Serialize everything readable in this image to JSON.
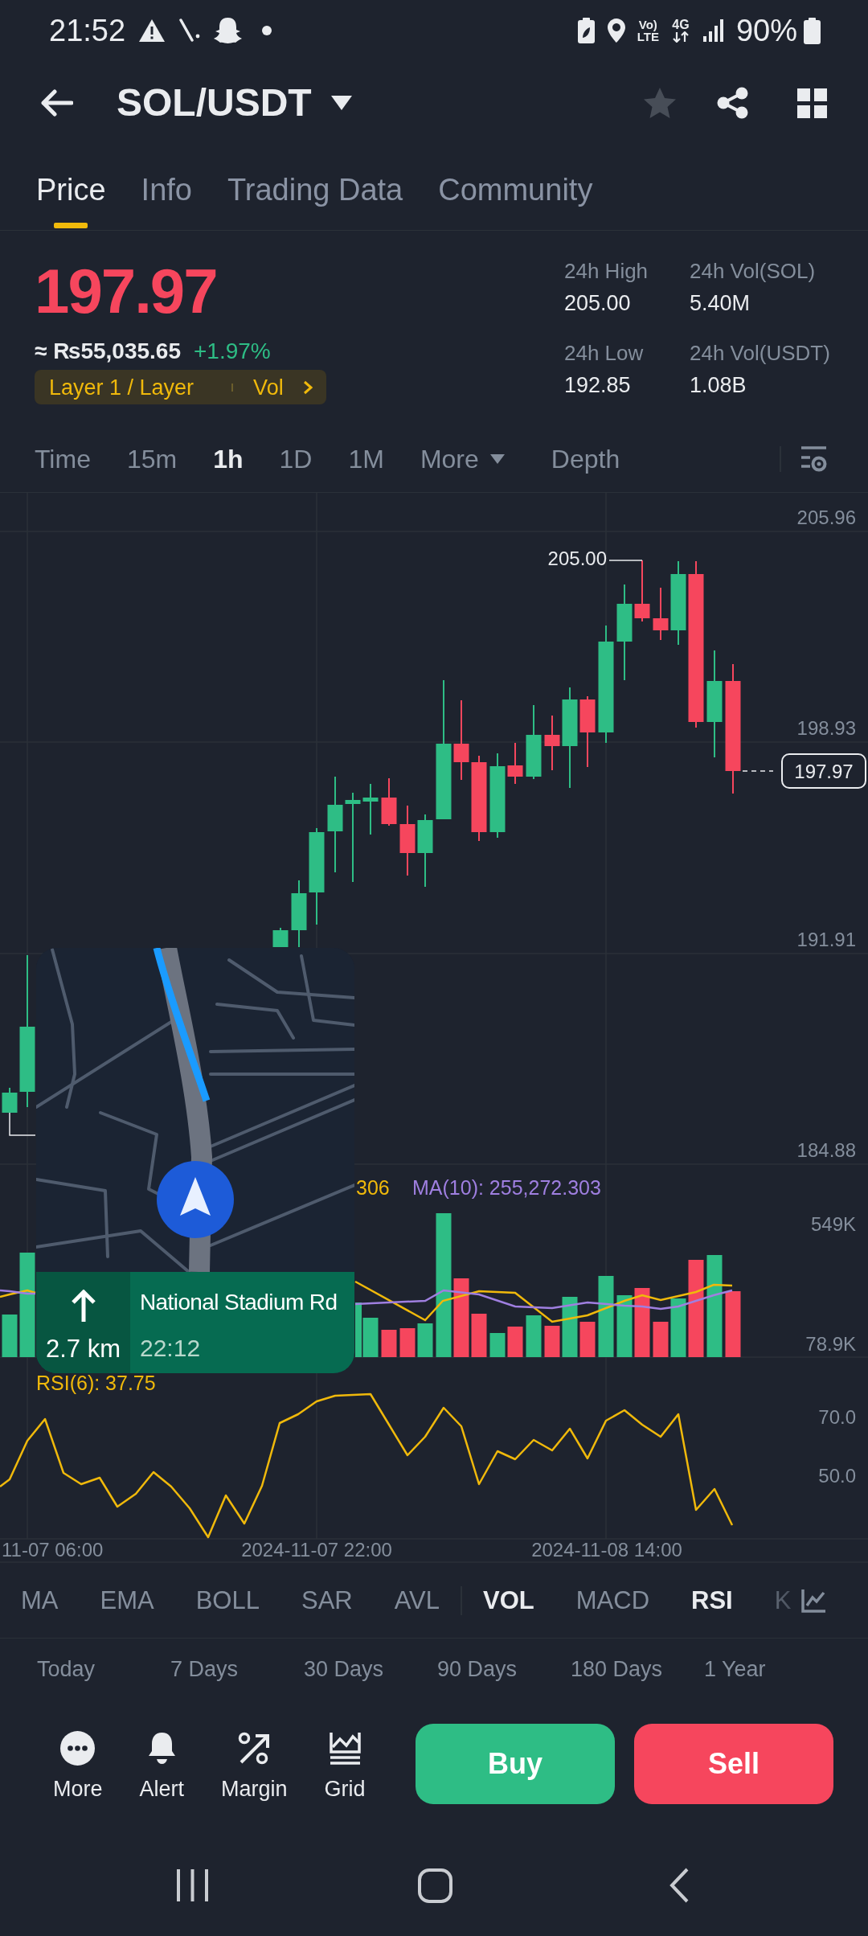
{
  "status_bar": {
    "time": "21:52",
    "volte_top": "Vo)",
    "volte_bottom": "LTE",
    "network": "4G",
    "battery": "90%"
  },
  "header": {
    "title": "SOL/USDT",
    "favorite": false
  },
  "tabs": [
    {
      "label": "Price",
      "selected": true
    },
    {
      "label": "Info",
      "selected": false
    },
    {
      "label": "Trading Data",
      "selected": false
    },
    {
      "label": "Community",
      "selected": false
    }
  ],
  "ticker": {
    "last_price": "197.97",
    "falling": true,
    "fiat_price": "≈ ₨55,035.65",
    "change": "+1.97%",
    "sector": "Layer 1 / Layer",
    "sector_link": "Vol",
    "stats": [
      {
        "label": "24h High",
        "value": "205.00"
      },
      {
        "label": "24h Vol(SOL)",
        "value": "5.40M"
      },
      {
        "label": "24h Low",
        "value": "192.85"
      },
      {
        "label": "24h Vol(USDT)",
        "value": "1.08B"
      }
    ]
  },
  "intervals": [
    {
      "label": "Time",
      "kind": "interval",
      "selected": false
    },
    {
      "label": "15m",
      "kind": "interval",
      "selected": false
    },
    {
      "label": "1h",
      "kind": "interval",
      "selected": true
    },
    {
      "label": "1D",
      "kind": "interval",
      "selected": false
    },
    {
      "label": "1M",
      "kind": "interval",
      "selected": false
    },
    {
      "label": "More",
      "kind": "dropdown",
      "selected": false
    },
    {
      "label": "Depth",
      "kind": "view",
      "selected": false
    }
  ],
  "chart": {
    "price_ticks": [
      "205.96",
      "198.93",
      "191.91",
      "184.88"
    ],
    "high_marker": "205.00",
    "current_price": "197.97",
    "volume_legend": [
      {
        "text": "306",
        "color": "#f0b90b"
      },
      {
        "text": "MA(10): 255,272.303",
        "color": "#9f7fe0"
      }
    ],
    "volume_ticks": [
      "549K",
      "78.9K"
    ],
    "rsi_legend": "RSI(6): 37.75",
    "rsi_ticks": [
      "70.0",
      "50.0"
    ],
    "time_labels": [
      "11-07 06:00",
      "2024-11-07 22:00",
      "2024-11-08 14:00"
    ]
  },
  "navigation_overlay": {
    "distance": "2.7 km",
    "street": "National Stadium Rd",
    "arrival": "22:12"
  },
  "main_indicators": [
    {
      "label": "MA",
      "selected": false
    },
    {
      "label": "EMA",
      "selected": false
    },
    {
      "label": "BOLL",
      "selected": false
    },
    {
      "label": "SAR",
      "selected": false
    },
    {
      "label": "AVL",
      "selected": false
    }
  ],
  "sub_indicators": [
    {
      "label": "VOL",
      "selected": true
    },
    {
      "label": "MACD",
      "selected": false
    },
    {
      "label": "RSI",
      "selected": true
    },
    {
      "label": "K",
      "selected": false
    }
  ],
  "performance": [
    "Today",
    "7 Days",
    "30 Days",
    "90 Days",
    "180 Days",
    "1 Year"
  ],
  "actions": [
    {
      "label": "More",
      "kind": "more"
    },
    {
      "label": "Alert",
      "kind": "alert"
    },
    {
      "label": "Margin",
      "kind": "margin"
    },
    {
      "label": "Grid",
      "kind": "grid"
    }
  ],
  "trade_buttons": [
    {
      "label": "Buy",
      "kind": "buy"
    },
    {
      "label": "Sell",
      "kind": "sell"
    }
  ]
}
